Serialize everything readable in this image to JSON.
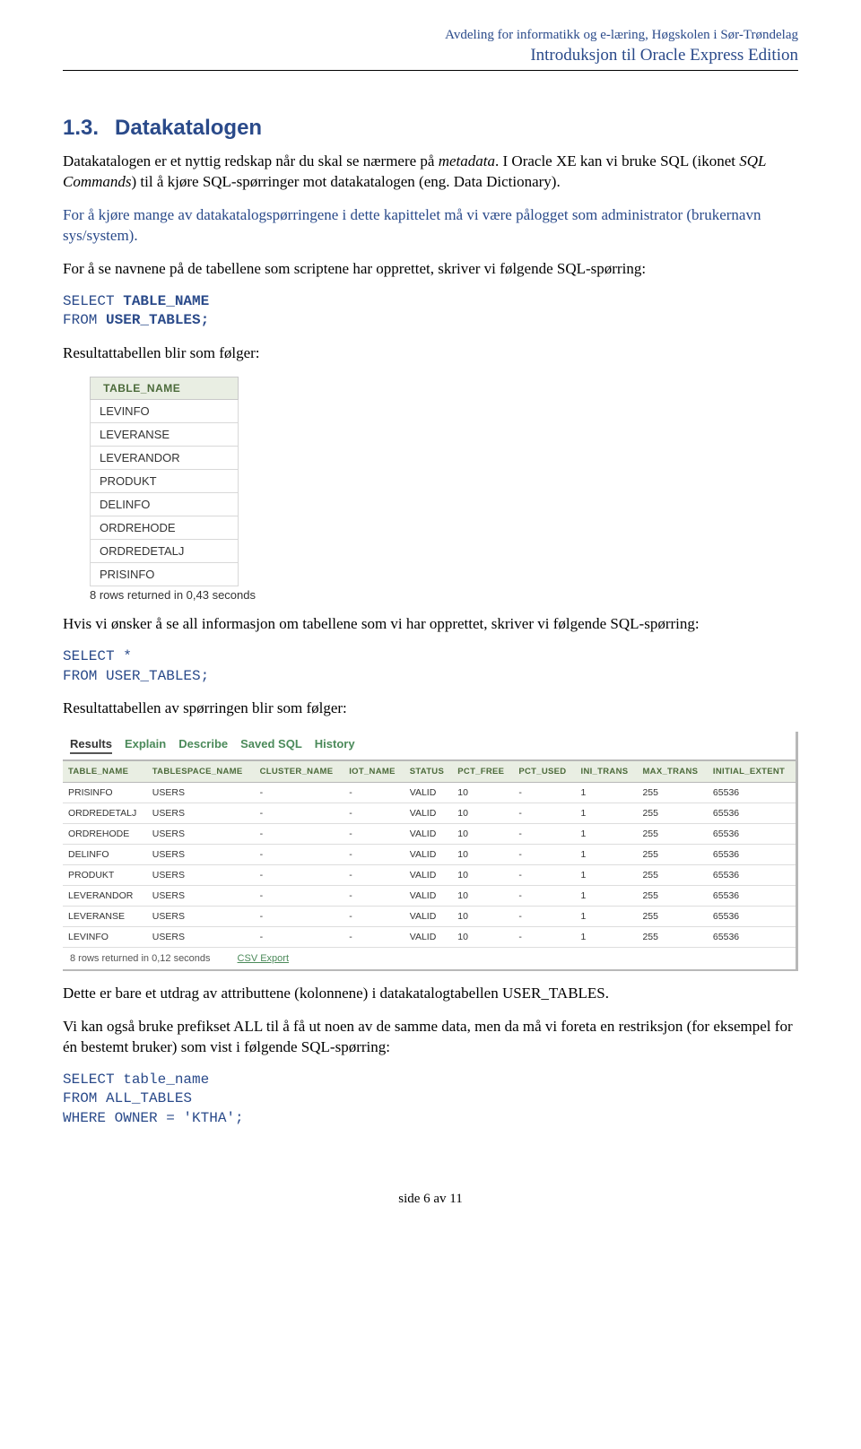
{
  "header": {
    "dept": "Avdeling for informatikk og e-læring, Høgskolen i Sør-Trøndelag",
    "title": "Introduksjon til Oracle Express Edition"
  },
  "section": {
    "number": "1.3.",
    "title": "Datakatalogen"
  },
  "para1_a": "Datakatalogen er et nyttig redskap når du skal se nærmere på ",
  "para1_meta": "metadata",
  "para1_b": ". I Oracle XE kan vi bruke SQL (ikonet ",
  "para1_sqlcmd": "SQL Commands",
  "para1_c": ") til å kjøre SQL-spørringer mot datakatalogen (eng. Data Dictionary).",
  "para2": "For å kjøre mange av datakatalogspørringene i dette kapittelet må vi være pålogget som administrator (brukernavn sys/system).",
  "para3": "For å se navnene på de tabellene som scriptene har opprettet, skriver vi følgende SQL-spørring:",
  "code1": {
    "l1a": "SELECT ",
    "l1b": "TABLE_NAME",
    "l2a": "FROM ",
    "l2b": "USER_TABLES;"
  },
  "para4": "Resultattabellen blir som følger:",
  "result1": {
    "header": "TABLE_NAME",
    "rows": [
      "LEVINFO",
      "LEVERANSE",
      "LEVERANDOR",
      "PRODUKT",
      "DELINFO",
      "ORDREHODE",
      "ORDREDETALJ",
      "PRISINFO"
    ],
    "footer": "8 rows returned in 0,43 seconds"
  },
  "para5": "Hvis vi ønsker å se all informasjon om tabellene som vi har opprettet, skriver vi følgende SQL-spørring:",
  "code2": {
    "l1": "SELECT *",
    "l2": "FROM USER_TABLES;"
  },
  "para6": "Resultattabellen av spørringen blir som følger:",
  "wide": {
    "tabs": [
      "Results",
      "Explain",
      "Describe",
      "Saved SQL",
      "History"
    ],
    "cols": [
      "TABLE_NAME",
      "TABLESPACE_NAME",
      "CLUSTER_NAME",
      "IOT_NAME",
      "STATUS",
      "PCT_FREE",
      "PCT_USED",
      "INI_TRANS",
      "MAX_TRANS",
      "INITIAL_EXTENT"
    ],
    "rows": [
      [
        "PRISINFO",
        "USERS",
        "-",
        "-",
        "VALID",
        "10",
        "-",
        "1",
        "255",
        "65536"
      ],
      [
        "ORDREDETALJ",
        "USERS",
        "-",
        "-",
        "VALID",
        "10",
        "-",
        "1",
        "255",
        "65536"
      ],
      [
        "ORDREHODE",
        "USERS",
        "-",
        "-",
        "VALID",
        "10",
        "-",
        "1",
        "255",
        "65536"
      ],
      [
        "DELINFO",
        "USERS",
        "-",
        "-",
        "VALID",
        "10",
        "-",
        "1",
        "255",
        "65536"
      ],
      [
        "PRODUKT",
        "USERS",
        "-",
        "-",
        "VALID",
        "10",
        "-",
        "1",
        "255",
        "65536"
      ],
      [
        "LEVERANDOR",
        "USERS",
        "-",
        "-",
        "VALID",
        "10",
        "-",
        "1",
        "255",
        "65536"
      ],
      [
        "LEVERANSE",
        "USERS",
        "-",
        "-",
        "VALID",
        "10",
        "-",
        "1",
        "255",
        "65536"
      ],
      [
        "LEVINFO",
        "USERS",
        "-",
        "-",
        "VALID",
        "10",
        "-",
        "1",
        "255",
        "65536"
      ]
    ],
    "footer": "8 rows returned in 0,12 seconds",
    "csv": "CSV Export"
  },
  "para7": "Dette er bare et utdrag av attributtene (kolonnene) i datakatalogtabellen USER_TABLES.",
  "para8": "Vi kan også bruke prefikset ALL til å få ut noen av de samme data, men da må vi foreta en restriksjon (for eksempel for én bestemt bruker) som vist i følgende SQL-spørring:",
  "code3": {
    "l1": "SELECT table_name",
    "l2": "FROM ALL_TABLES",
    "l3": "WHERE OWNER = 'KTHA';"
  },
  "pagenum": "side 6 av 11"
}
